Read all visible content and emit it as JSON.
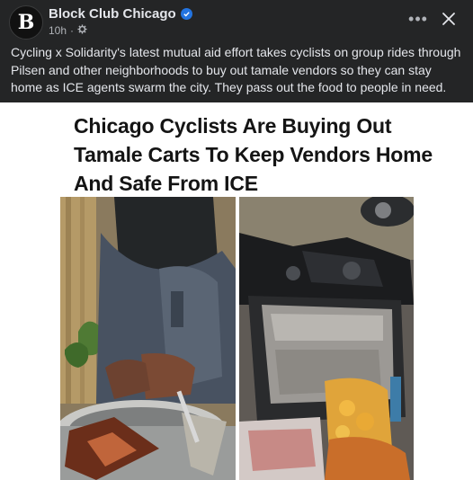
{
  "post": {
    "page_name": "Block Club Chicago",
    "avatar_letter": "B",
    "time_ago": "10h",
    "audience_icon": "gear-icon",
    "caption": "Cycling x Solidarity's latest mutual aid effort takes cyclists on group rides through Pilsen and other neighborhoods to buy out tamale vendors so they can stay home as ICE agents swarm the city. They pass out the food to people in need."
  },
  "header_actions": {
    "more_icon": "more-options-icon",
    "more_glyph": "•••",
    "close_icon": "close-icon"
  },
  "article": {
    "headline": "Chicago Cyclists Are Buying Out Tamale Carts To Keep Vendors Home And Safe From ICE",
    "photos": [
      "vendor-with-tamale-pot-photo",
      "bike-bag-with-tamales-photo"
    ]
  },
  "colors": {
    "background": "#242526",
    "verified_badge": "#2374e1",
    "text_primary": "#e4e6eb",
    "text_secondary": "#b0b3b8"
  }
}
